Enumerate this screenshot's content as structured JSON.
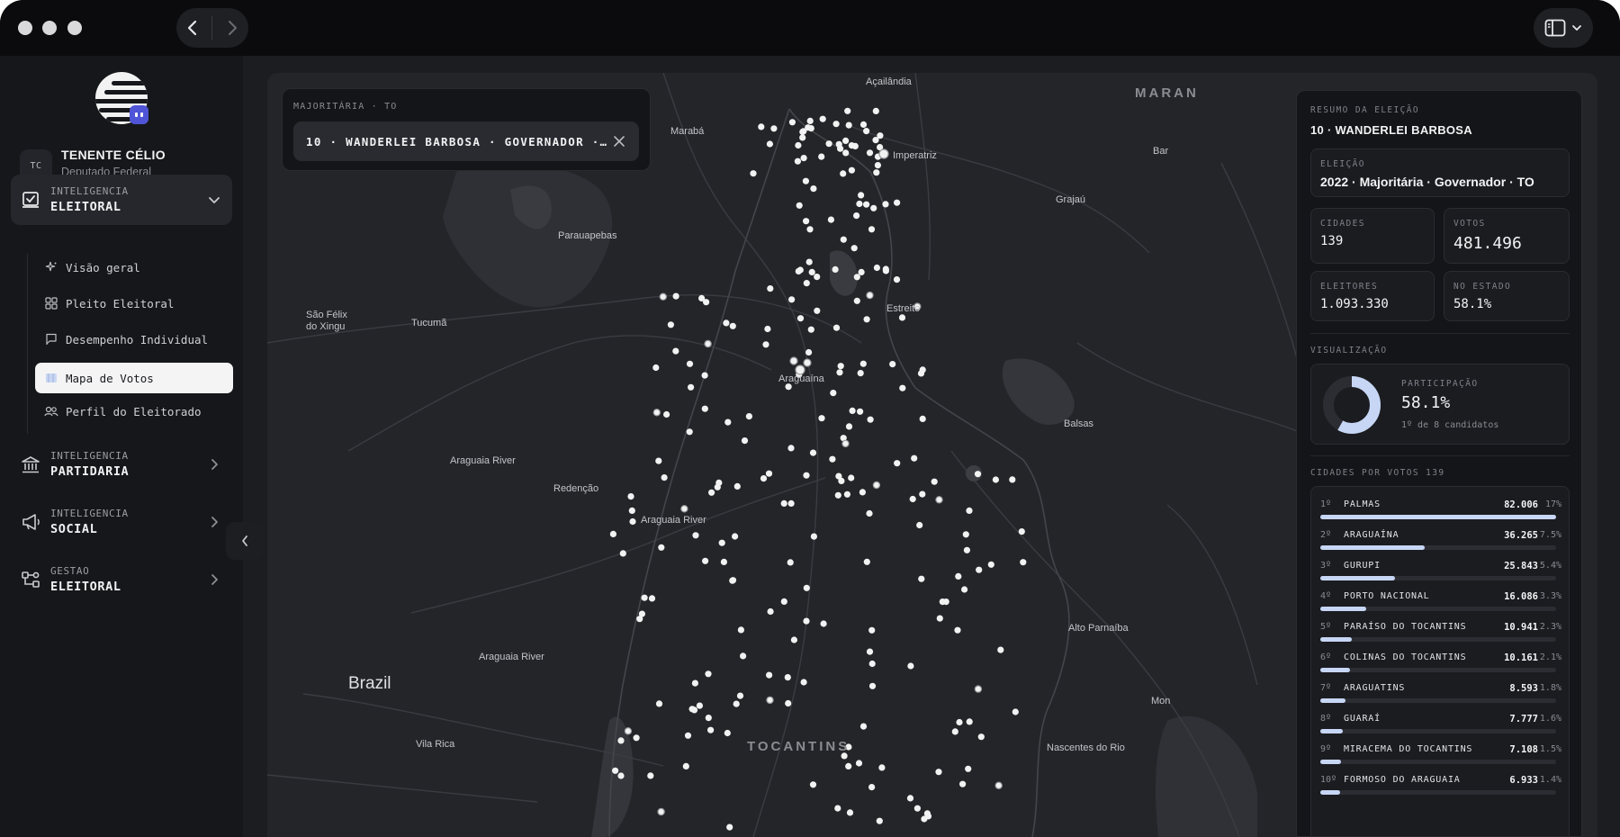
{
  "sidebar": {
    "user": {
      "initials": "TC",
      "name": "TENENTE CÉLIO",
      "role": "Deputado Federal"
    },
    "groups": [
      {
        "line1": "INTELIGENCIA",
        "line2": "ELEITORAL",
        "icon": "ballot-icon",
        "expanded": true
      },
      {
        "line1": "INTELIGENCIA",
        "line2": "PARTIDARIA",
        "icon": "bank-icon",
        "expanded": false
      },
      {
        "line1": "INTELIGENCIA",
        "line2": "SOCIAL",
        "icon": "megaphone-icon",
        "expanded": false
      },
      {
        "line1": "GESTAO",
        "line2": "ELEITORAL",
        "icon": "workflow-icon",
        "expanded": false
      }
    ],
    "subitems": [
      {
        "label": "Visão geral",
        "icon": "sparkle-icon"
      },
      {
        "label": "Pleito Eleitoral",
        "icon": "grid-icon"
      },
      {
        "label": "Desempenho Individual",
        "icon": "flag-icon"
      },
      {
        "label": "Mapa de Votos",
        "icon": "map-icon",
        "active": true
      },
      {
        "label": "Perfil do Eleitorado",
        "icon": "users-icon"
      }
    ]
  },
  "filter": {
    "label": "MAJORITÁRIA · TO",
    "value": "10 · WANDERLEI BARBOSA · GOVERNADOR ·…"
  },
  "map": {
    "labels": [
      {
        "text": "Açailândia"
      },
      {
        "text": "Marabá"
      },
      {
        "text": "Imperatriz"
      },
      {
        "text": "MARAN"
      },
      {
        "text": "Bar"
      },
      {
        "text": "Grajaú"
      },
      {
        "text": "Parauapebas"
      },
      {
        "text": "São Félix"
      },
      {
        "text": "do Xingu"
      },
      {
        "text": "Tucumã"
      },
      {
        "text": "Estreito"
      },
      {
        "text": "Araguaína"
      },
      {
        "text": "Balsas"
      },
      {
        "text": "Araguaia River"
      },
      {
        "text": "Redenção"
      },
      {
        "text": "Araguaia River"
      },
      {
        "text": "Alto Parnaíba"
      },
      {
        "text": "Araguaia River"
      },
      {
        "text": "Brazil"
      },
      {
        "text": "Vila Rica"
      },
      {
        "text": "TOCANTINS"
      },
      {
        "text": "Nascentes do Rio"
      },
      {
        "text": "Mon"
      }
    ]
  },
  "panel": {
    "summary_label": "RESUMO DA ELEIÇÃO",
    "candidate": "10 · WANDERLEI BARBOSA",
    "election_label": "ELEIÇÃO",
    "election_value": "2022 · Majoritária · Governador · TO",
    "stats": [
      {
        "label": "CIDADES",
        "value": "139"
      },
      {
        "label": "VOTOS",
        "value": "481.496"
      },
      {
        "label": "ELEITORES",
        "value": "1.093.330"
      },
      {
        "label": "NO ESTADO",
        "value": "58.1%"
      }
    ],
    "viz_label": "VISUALIZAÇÃO",
    "participation": {
      "label": "PARTICIPAÇÃO",
      "value": "58.1%",
      "fraction": 0.581,
      "sub": "1º de 8 candidatos"
    },
    "cities_label": "CIDADES POR VOTOS",
    "cities_count": "139",
    "cities": [
      {
        "rank": "1º",
        "name": "PALMAS",
        "votes": "82.006",
        "pct": "17%",
        "fraction": 1.0
      },
      {
        "rank": "2º",
        "name": "ARAGUAÍNA",
        "votes": "36.265",
        "pct": "7.5%",
        "fraction": 0.442
      },
      {
        "rank": "3º",
        "name": "GURUPI",
        "votes": "25.843",
        "pct": "5.4%",
        "fraction": 0.315
      },
      {
        "rank": "4º",
        "name": "PORTO NACIONAL",
        "votes": "16.086",
        "pct": "3.3%",
        "fraction": 0.196
      },
      {
        "rank": "5º",
        "name": "PARAÍSO DO TOCANTINS",
        "votes": "10.941",
        "pct": "2.3%",
        "fraction": 0.133
      },
      {
        "rank": "6º",
        "name": "COLINAS DO TOCANTINS",
        "votes": "10.161",
        "pct": "2.1%",
        "fraction": 0.124
      },
      {
        "rank": "7º",
        "name": "ARAGUATINS",
        "votes": "8.593",
        "pct": "1.8%",
        "fraction": 0.105
      },
      {
        "rank": "8º",
        "name": "GUARAÍ",
        "votes": "7.777",
        "pct": "1.6%",
        "fraction": 0.095
      },
      {
        "rank": "9º",
        "name": "MIRACEMA DO TOCANTINS",
        "votes": "7.108",
        "pct": "1.5%",
        "fraction": 0.087
      },
      {
        "rank": "10º",
        "name": "FORMOSO DO ARAGUAIA",
        "votes": "6.933",
        "pct": "1.4%",
        "fraction": 0.085
      }
    ]
  },
  "colors": {
    "accent_bar": "#c7d6f5",
    "active_bg": "#f4f4f5",
    "badge": "#4f55d6"
  }
}
